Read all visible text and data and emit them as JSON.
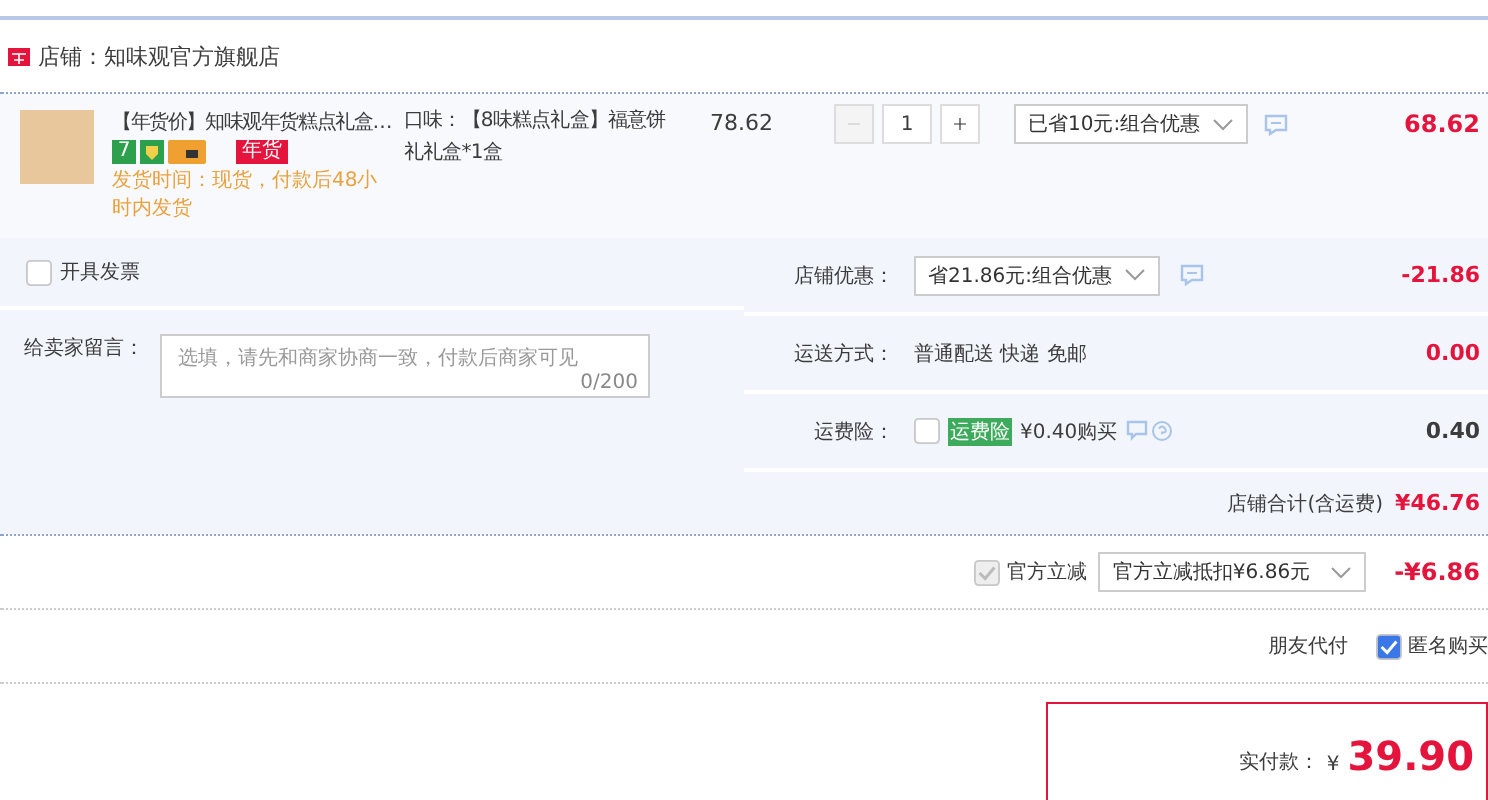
{
  "shop": {
    "label": "店铺：知味观官方旗舰店"
  },
  "item": {
    "title": "【年货价】知味观年货糕点礼盒…",
    "service_tag": "7",
    "badge": "年货",
    "shipping": "发货时间：现货，付款后48小时内发货",
    "attribute": "口味：【8味糕点礼盒】福意饼礼礼盒*1盒",
    "price": "78.62",
    "quantity": "1",
    "minus_disabled": true,
    "discount": "已省10元:组合优惠",
    "subtotal": "68.62"
  },
  "invoice": {
    "label": "开具发票",
    "checked": false
  },
  "message": {
    "label": "给卖家留言：",
    "placeholder": "选填，请先和商家协商一致，付款后商家可见",
    "counter": "0/200"
  },
  "fees": [
    {
      "kind": "select",
      "label": "店铺优惠：",
      "value": "省21.86元:组合优惠",
      "amount": "-21.86",
      "emphasis": true
    },
    {
      "kind": "text",
      "label": "运送方式：",
      "value": "普通配送 快递 免邮",
      "amount": "0.00",
      "emphasis": true
    },
    {
      "kind": "insurance",
      "label": "运费险：",
      "tag": "运费险",
      "value": "¥0.40购买",
      "checked": false,
      "amount": "0.40",
      "emphasis": false
    }
  ],
  "shop_total": {
    "label": "店铺合计(含运费)",
    "amount": "¥46.76"
  },
  "official": {
    "checked": true,
    "disabled": true,
    "label": "官方立减",
    "value": "官方立减抵扣¥6.86元",
    "amount": "-¥6.86"
  },
  "options": [
    {
      "kind": "link",
      "label": "朋友代付"
    },
    {
      "kind": "checkbox",
      "label": "匿名购买",
      "checked": true
    }
  ],
  "payment": {
    "label": "实付款：",
    "currency": "¥",
    "amount": "39.90"
  }
}
